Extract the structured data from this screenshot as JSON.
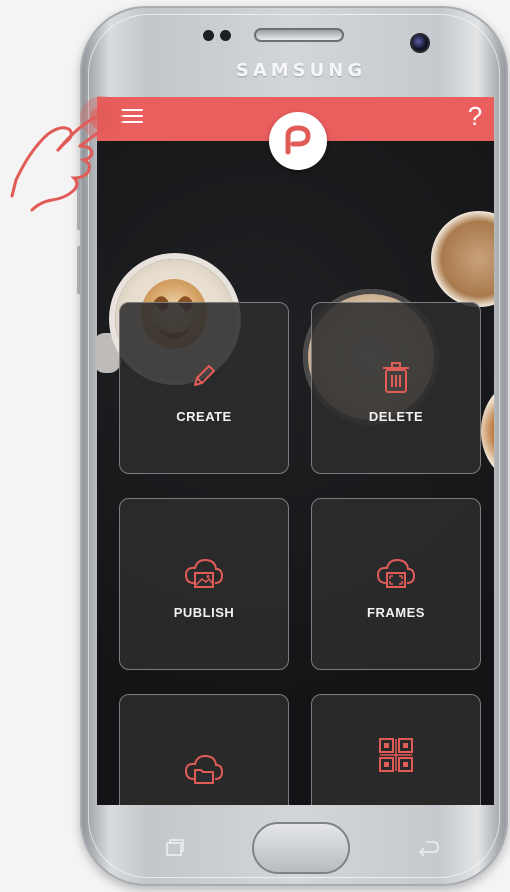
{
  "device": {
    "brand": "SAMSUNG"
  },
  "header": {
    "help_symbol": "?",
    "accent_color": "#ea5e5e"
  },
  "tiles": [
    {
      "label": "CREATE",
      "icon": "pencil-icon"
    },
    {
      "label": "DELETE",
      "icon": "trash-icon"
    },
    {
      "label": "PUBLISH",
      "icon": "cloud-image-icon"
    },
    {
      "label": "FRAMES",
      "icon": "cloud-frame-icon"
    },
    {
      "label": "",
      "icon": "cloud-folder-icon"
    },
    {
      "label": "",
      "icon": "qr-code-icon"
    }
  ],
  "colors": {
    "icon": "#e15b57",
    "tile_bg": "#2c2c2e",
    "screen_bg": "#1b1b1d"
  }
}
